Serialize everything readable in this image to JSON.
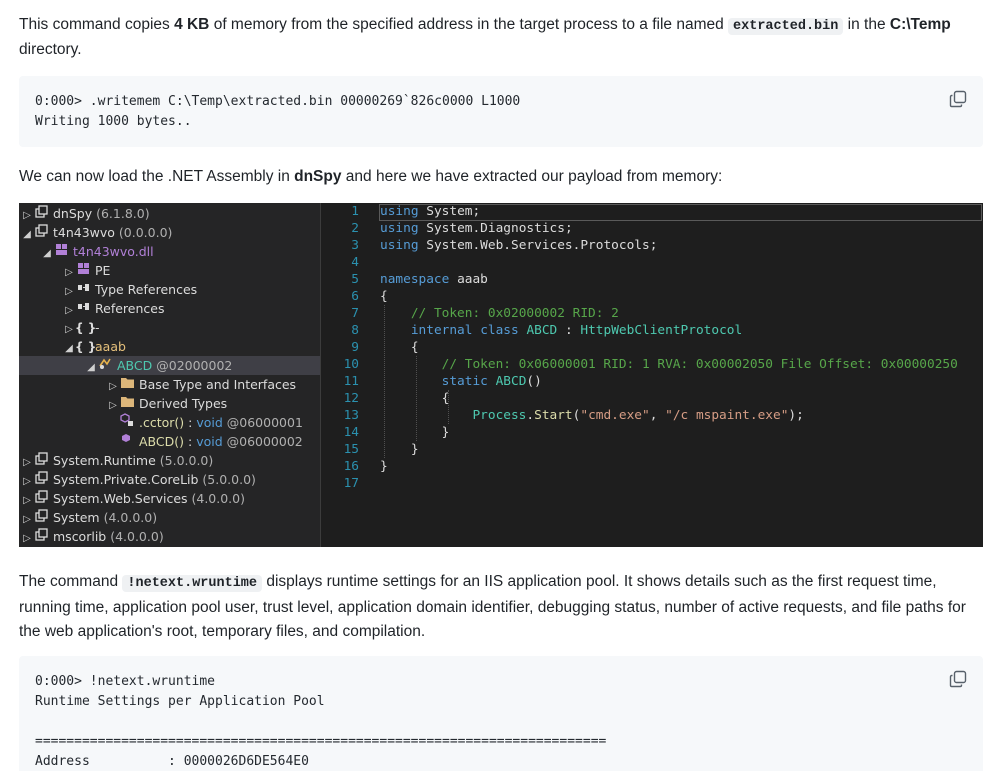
{
  "para1": {
    "t1": "This command copies ",
    "b1": "4 KB",
    "t2": " of memory from the specified address in the target process to a file named ",
    "code": "extracted.bin",
    "t3": " in the ",
    "b2": "C:\\Temp",
    "t4": " directory."
  },
  "code1": {
    "lines": [
      "0:000> .writemem C:\\Temp\\extracted.bin 00000269`826c0000 L1000",
      "Writing 1000 bytes.."
    ]
  },
  "para2": {
    "t1": "We can now load the .NET Assembly in ",
    "b1": "dnSpy",
    "t2": " and here we have extracted our payload from memory:"
  },
  "tree": {
    "items": [
      {
        "name": "dnSpy",
        "ver": " (6.1.8.0)"
      },
      {
        "name": "t4n43wvo",
        "ver": " (0.0.0.0)"
      },
      {
        "name": "t4n43wvo.dll"
      },
      {
        "name": "PE"
      },
      {
        "name": "Type References"
      },
      {
        "name": "References"
      },
      {
        "name": "-"
      },
      {
        "name": "aaab"
      },
      {
        "name": "ABCD",
        "ver": " @02000002"
      },
      {
        "name": "Base Type and Interfaces"
      },
      {
        "name": "Derived Types"
      },
      {
        "name": ".cctor()",
        "sep": " : ",
        "type": "void",
        "ver": " @06000001"
      },
      {
        "name": "ABCD()",
        "sep": " : ",
        "type": "void",
        "ver": " @06000002"
      },
      {
        "name": "System.Runtime",
        "ver": " (5.0.0.0)"
      },
      {
        "name": "System.Private.CoreLib",
        "ver": " (5.0.0.0)"
      },
      {
        "name": "System.Web.Services",
        "ver": " (4.0.0.0)"
      },
      {
        "name": "System",
        "ver": " (4.0.0.0)"
      },
      {
        "name": "mscorlib",
        "ver": " (4.0.0.0)"
      }
    ]
  },
  "editor": {
    "line_numbers": [
      "1",
      "2",
      "3",
      "4",
      "5",
      "6",
      "7",
      "8",
      "9",
      "10",
      "11",
      "12",
      "13",
      "14",
      "15",
      "16",
      "17"
    ],
    "tokens": {
      "using": "using",
      "system": "System",
      "system_diag": "System.Diagnostics",
      "system_web": "System.Web.Services.Protocols",
      "semi": ";",
      "namespace": "namespace",
      "ns_name": "aaab",
      "open": "{",
      "close": "}",
      "comment1": "// Token: 0x02000002 RID: 2",
      "internal": "internal",
      "class": "class",
      "class_name": "ABCD",
      "colon": " : ",
      "base": "HttpWebClientProtocol",
      "comment2": "// Token: 0x06000001 RID: 1 RVA: 0x00002050 File Offset: 0x00000250",
      "static": "static",
      "ctor": "ABCD",
      "parens": "()",
      "process": "Process",
      "dot": ".",
      "start": "Start",
      "lparen": "(",
      "arg1": "\"cmd.exe\"",
      "comma": ", ",
      "arg2": "\"/c mspaint.exe\"",
      "rparen_semi": ");"
    }
  },
  "para3": {
    "t1": "The command ",
    "code": "!netext.wruntime",
    "t2": " displays runtime settings for an IIS application pool. It shows details such as the first request time, running time, application pool user, trust level, application domain identifier, debugging status, number of active requests, and file paths for the web application's root, temporary files, and compilation."
  },
  "code2": {
    "lines": [
      "0:000> !netext.wruntime",
      "Runtime Settings per Application Pool",
      "",
      "=========================================================================",
      "Address          : 0000026D6DE564E0"
    ]
  },
  "icons": {
    "copy": "copy-icon",
    "expand": "triangle-right-icon",
    "collapse": "triangle-down-icon",
    "assembly": "assembly-icon",
    "module": "module-icon",
    "namespace": "namespace-icon",
    "folder": "folder-icon",
    "class": "class-icon",
    "method": "method-icon"
  },
  "colors": {
    "keyword": "#569cd6",
    "comment": "#57a64a",
    "type": "#4ec9b0",
    "string": "#d69d85",
    "method": "#dcdcaa",
    "line_number": "#2b91af"
  }
}
